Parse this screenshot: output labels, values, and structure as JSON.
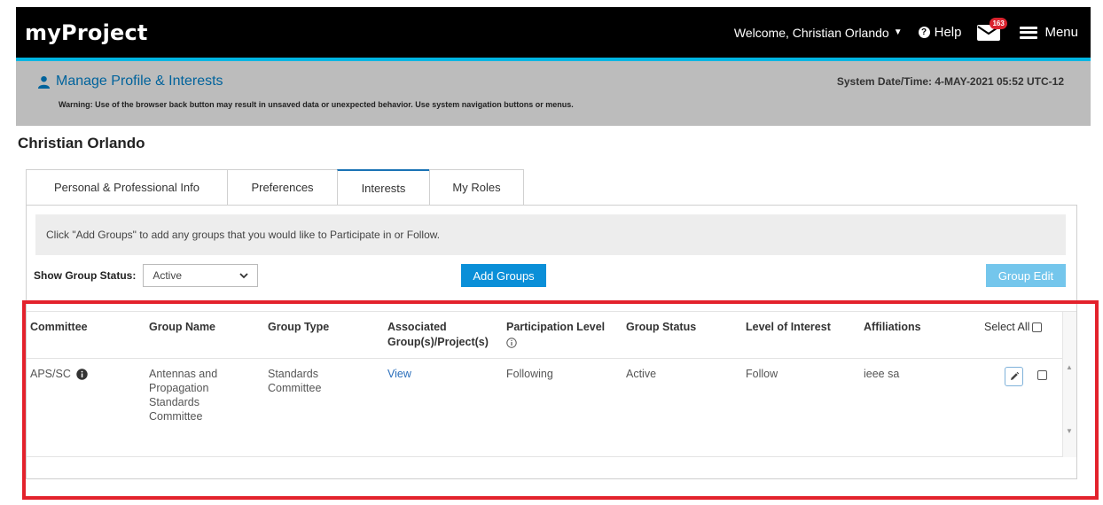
{
  "app": {
    "brand": "myProject",
    "welcome": "Welcome, Christian Orlando",
    "help_label": "Help",
    "mail_count": "163",
    "menu_label": "Menu"
  },
  "header": {
    "title": "Manage Profile & Interests",
    "warning": "Warning: Use of the browser back button may result in unsaved data or unexpected behavior. Use system navigation buttons or menus.",
    "system_date": "System Date/Time: 4-MAY-2021   05:52 UTC-12"
  },
  "person_name": "Christian Orlando",
  "tabs": [
    {
      "label": "Personal & Professional Info"
    },
    {
      "label": "Preferences"
    },
    {
      "label": "Interests"
    },
    {
      "label": "My Roles"
    }
  ],
  "info_text": "Click \"Add Groups\" to add any groups that you would like to Participate in or Follow.",
  "filters": {
    "status_label": "Show Group Status:",
    "status_value": "Active",
    "add_groups_label": "Add Groups",
    "group_edit_label": "Group Edit"
  },
  "table": {
    "headers": {
      "committee": "Committee",
      "group_name": "Group Name",
      "group_type": "Group Type",
      "associated_line1": "Associated",
      "associated_line2": "Group(s)/Project(s)",
      "participation": "Participation Level",
      "group_status": "Group Status",
      "level_interest": "Level of Interest",
      "affiliations": "Affiliations",
      "select_all": "Select All"
    },
    "rows": [
      {
        "committee": "APS/SC",
        "group_name": "Antennas and Propagation Standards Committee",
        "group_type": "Standards Committee",
        "associated": "View",
        "participation": "Following",
        "group_status": "Active",
        "level_interest": "Follow",
        "affiliations": "ieee sa"
      }
    ]
  },
  "colors": {
    "accent_blue": "#0a8fd8",
    "highlight_red": "#e3222c",
    "top_border": "#00b5e2"
  }
}
